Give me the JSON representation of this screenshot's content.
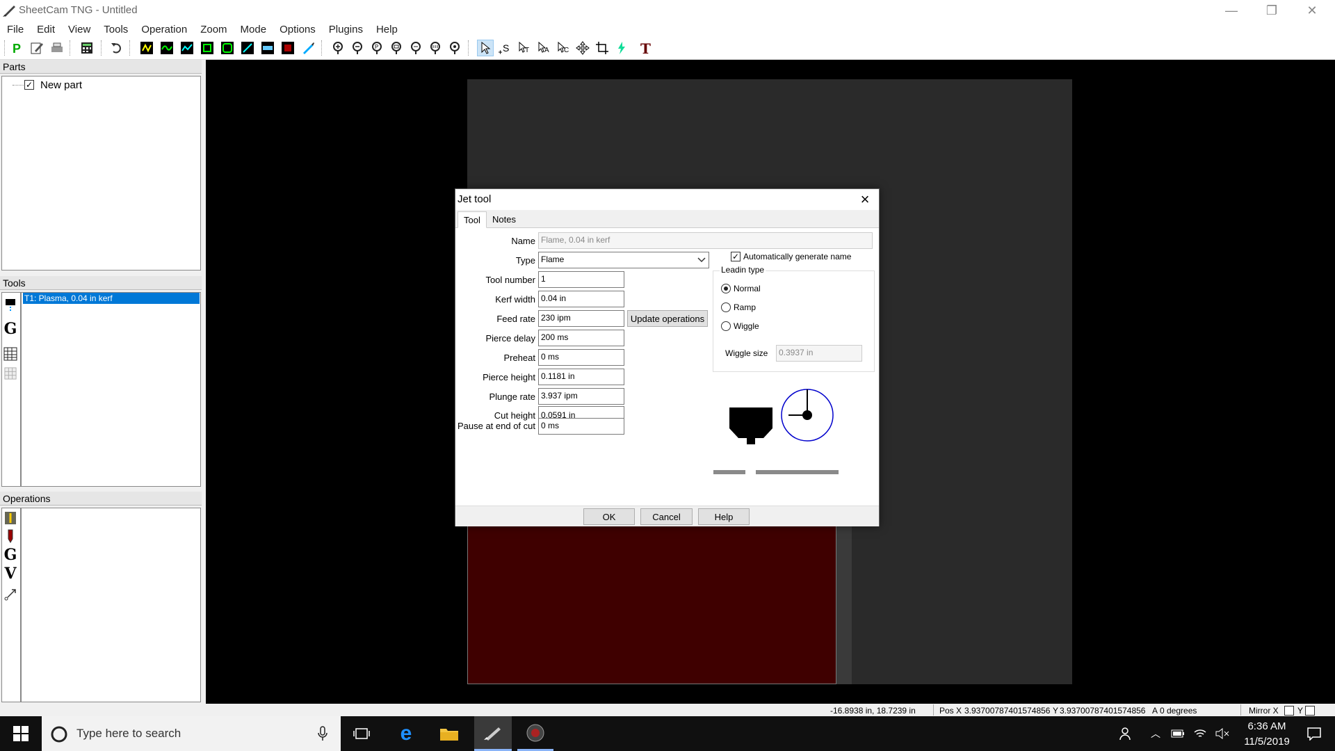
{
  "window": {
    "title": "SheetCam TNG - Untitled"
  },
  "menu": [
    "File",
    "Edit",
    "View",
    "Tools",
    "Operation",
    "Zoom",
    "Mode",
    "Options",
    "Plugins",
    "Help"
  ],
  "panels": {
    "parts": {
      "header": "Parts",
      "items": [
        "New part"
      ]
    },
    "tools": {
      "header": "Tools",
      "items": [
        "T1: Plasma, 0.04 in kerf"
      ]
    },
    "operations": {
      "header": "Operations"
    }
  },
  "dialog": {
    "title": "Jet tool",
    "tabs": [
      "Tool",
      "Notes"
    ],
    "fields": {
      "name": {
        "label": "Name",
        "value": "Flame, 0.04 in kerf"
      },
      "type": {
        "label": "Type",
        "value": "Flame"
      },
      "tool_number": {
        "label": "Tool number",
        "value": "1"
      },
      "kerf_width": {
        "label": "Kerf width",
        "value": "0.04 in"
      },
      "feed_rate": {
        "label": "Feed rate",
        "value": "230 ipm"
      },
      "pierce_delay": {
        "label": "Pierce delay",
        "value": "200 ms"
      },
      "preheat": {
        "label": "Preheat",
        "value": "0 ms"
      },
      "pierce_height": {
        "label": "Pierce height",
        "value": "0.1181 in"
      },
      "plunge_rate": {
        "label": "Plunge rate",
        "value": "3.937 ipm"
      },
      "cut_height": {
        "label": "Cut height",
        "value": "0.0591 in"
      },
      "pause_end": {
        "label": "Pause at end of cut",
        "value": "0 ms"
      }
    },
    "auto_name": {
      "label": "Automatically generate name",
      "checked": true
    },
    "update_ops": "Update operations",
    "leadin": {
      "legend": "Leadin type",
      "options": [
        "Normal",
        "Ramp",
        "Wiggle"
      ],
      "selected": "Normal",
      "wiggle_label": "Wiggle size",
      "wiggle_value": "0.3937 in"
    },
    "buttons": {
      "ok": "OK",
      "cancel": "Cancel",
      "help": "Help"
    }
  },
  "status": {
    "coords": "-16.8938 in, 18.7239 in",
    "pos_x_label": "Pos X",
    "pos_x": "3.93700787401574856",
    "pos_y_label": "Y",
    "pos_y": "3.93700787401574856",
    "a_label": "A",
    "a_value": "0 degrees",
    "mirror_x": "Mirror X",
    "mirror_y": "Y"
  },
  "taskbar": {
    "search_placeholder": "Type here to search",
    "time": "6:36 AM",
    "date": "11/5/2019"
  },
  "colors": {
    "selection": "#0078d7",
    "part_fill": "#3f0000",
    "canvas": "#000000",
    "sheet": "#2a2a2a"
  }
}
